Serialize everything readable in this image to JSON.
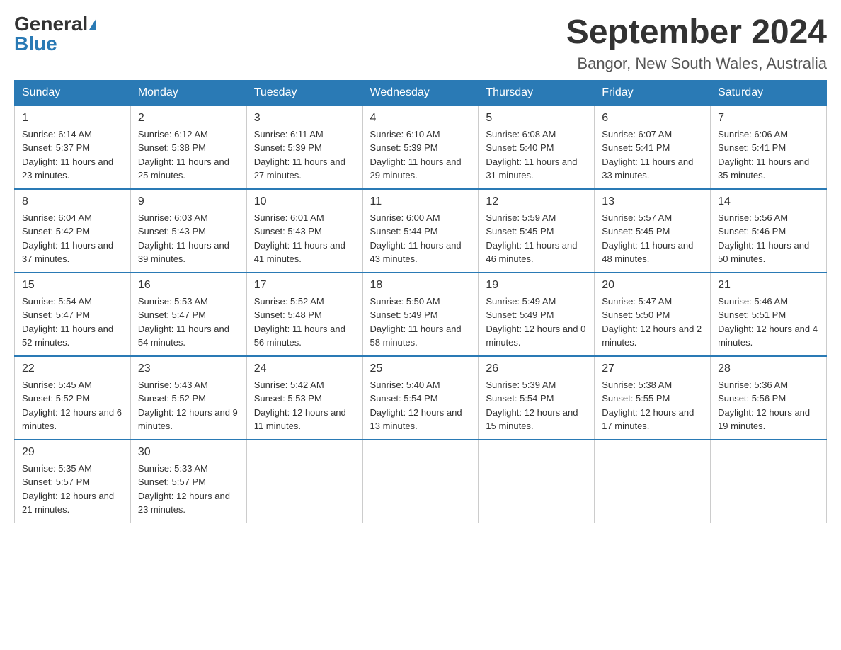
{
  "header": {
    "logo_general": "General",
    "logo_blue": "Blue",
    "month_year": "September 2024",
    "location": "Bangor, New South Wales, Australia"
  },
  "weekdays": [
    "Sunday",
    "Monday",
    "Tuesday",
    "Wednesday",
    "Thursday",
    "Friday",
    "Saturday"
  ],
  "weeks": [
    [
      {
        "day": "1",
        "sunrise": "6:14 AM",
        "sunset": "5:37 PM",
        "daylight": "11 hours and 23 minutes."
      },
      {
        "day": "2",
        "sunrise": "6:12 AM",
        "sunset": "5:38 PM",
        "daylight": "11 hours and 25 minutes."
      },
      {
        "day": "3",
        "sunrise": "6:11 AM",
        "sunset": "5:39 PM",
        "daylight": "11 hours and 27 minutes."
      },
      {
        "day": "4",
        "sunrise": "6:10 AM",
        "sunset": "5:39 PM",
        "daylight": "11 hours and 29 minutes."
      },
      {
        "day": "5",
        "sunrise": "6:08 AM",
        "sunset": "5:40 PM",
        "daylight": "11 hours and 31 minutes."
      },
      {
        "day": "6",
        "sunrise": "6:07 AM",
        "sunset": "5:41 PM",
        "daylight": "11 hours and 33 minutes."
      },
      {
        "day": "7",
        "sunrise": "6:06 AM",
        "sunset": "5:41 PM",
        "daylight": "11 hours and 35 minutes."
      }
    ],
    [
      {
        "day": "8",
        "sunrise": "6:04 AM",
        "sunset": "5:42 PM",
        "daylight": "11 hours and 37 minutes."
      },
      {
        "day": "9",
        "sunrise": "6:03 AM",
        "sunset": "5:43 PM",
        "daylight": "11 hours and 39 minutes."
      },
      {
        "day": "10",
        "sunrise": "6:01 AM",
        "sunset": "5:43 PM",
        "daylight": "11 hours and 41 minutes."
      },
      {
        "day": "11",
        "sunrise": "6:00 AM",
        "sunset": "5:44 PM",
        "daylight": "11 hours and 43 minutes."
      },
      {
        "day": "12",
        "sunrise": "5:59 AM",
        "sunset": "5:45 PM",
        "daylight": "11 hours and 46 minutes."
      },
      {
        "day": "13",
        "sunrise": "5:57 AM",
        "sunset": "5:45 PM",
        "daylight": "11 hours and 48 minutes."
      },
      {
        "day": "14",
        "sunrise": "5:56 AM",
        "sunset": "5:46 PM",
        "daylight": "11 hours and 50 minutes."
      }
    ],
    [
      {
        "day": "15",
        "sunrise": "5:54 AM",
        "sunset": "5:47 PM",
        "daylight": "11 hours and 52 minutes."
      },
      {
        "day": "16",
        "sunrise": "5:53 AM",
        "sunset": "5:47 PM",
        "daylight": "11 hours and 54 minutes."
      },
      {
        "day": "17",
        "sunrise": "5:52 AM",
        "sunset": "5:48 PM",
        "daylight": "11 hours and 56 minutes."
      },
      {
        "day": "18",
        "sunrise": "5:50 AM",
        "sunset": "5:49 PM",
        "daylight": "11 hours and 58 minutes."
      },
      {
        "day": "19",
        "sunrise": "5:49 AM",
        "sunset": "5:49 PM",
        "daylight": "12 hours and 0 minutes."
      },
      {
        "day": "20",
        "sunrise": "5:47 AM",
        "sunset": "5:50 PM",
        "daylight": "12 hours and 2 minutes."
      },
      {
        "day": "21",
        "sunrise": "5:46 AM",
        "sunset": "5:51 PM",
        "daylight": "12 hours and 4 minutes."
      }
    ],
    [
      {
        "day": "22",
        "sunrise": "5:45 AM",
        "sunset": "5:52 PM",
        "daylight": "12 hours and 6 minutes."
      },
      {
        "day": "23",
        "sunrise": "5:43 AM",
        "sunset": "5:52 PM",
        "daylight": "12 hours and 9 minutes."
      },
      {
        "day": "24",
        "sunrise": "5:42 AM",
        "sunset": "5:53 PM",
        "daylight": "12 hours and 11 minutes."
      },
      {
        "day": "25",
        "sunrise": "5:40 AM",
        "sunset": "5:54 PM",
        "daylight": "12 hours and 13 minutes."
      },
      {
        "day": "26",
        "sunrise": "5:39 AM",
        "sunset": "5:54 PM",
        "daylight": "12 hours and 15 minutes."
      },
      {
        "day": "27",
        "sunrise": "5:38 AM",
        "sunset": "5:55 PM",
        "daylight": "12 hours and 17 minutes."
      },
      {
        "day": "28",
        "sunrise": "5:36 AM",
        "sunset": "5:56 PM",
        "daylight": "12 hours and 19 minutes."
      }
    ],
    [
      {
        "day": "29",
        "sunrise": "5:35 AM",
        "sunset": "5:57 PM",
        "daylight": "12 hours and 21 minutes."
      },
      {
        "day": "30",
        "sunrise": "5:33 AM",
        "sunset": "5:57 PM",
        "daylight": "12 hours and 23 minutes."
      },
      null,
      null,
      null,
      null,
      null
    ]
  ]
}
